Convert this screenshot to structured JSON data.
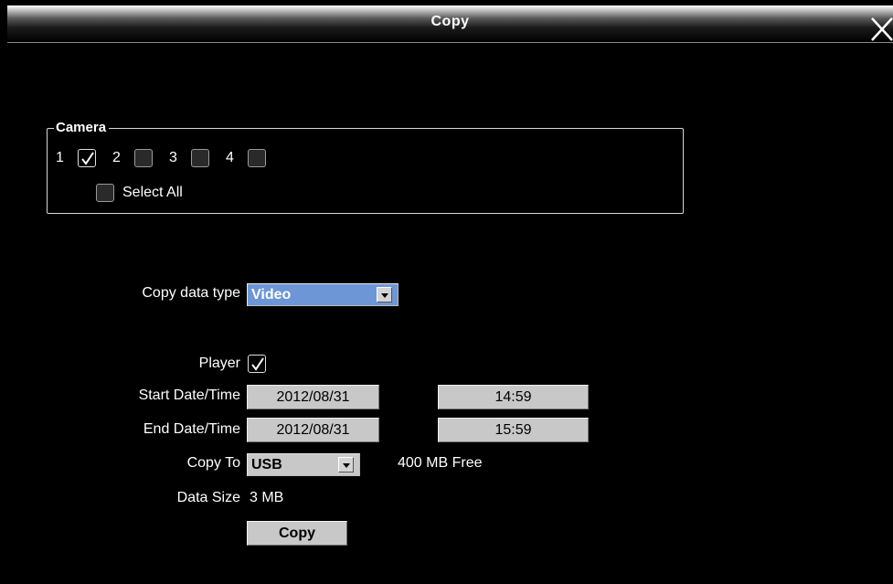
{
  "window": {
    "title": "Copy"
  },
  "camera": {
    "legend": "Camera",
    "channels": [
      {
        "label": "1",
        "checked": true
      },
      {
        "label": "2",
        "checked": false
      },
      {
        "label": "3",
        "checked": false
      },
      {
        "label": "4",
        "checked": false
      }
    ],
    "select_all_label": "Select All",
    "select_all_checked": false
  },
  "form": {
    "copy_data_type_label": "Copy data type",
    "copy_data_type_value": "Video",
    "player_label": "Player",
    "player_checked": true,
    "start_label": "Start Date/Time",
    "start_date": "2012/08/31",
    "start_time": "14:59",
    "end_label": "End Date/Time",
    "end_date": "2012/08/31",
    "end_time": "15:59",
    "copy_to_label": "Copy To",
    "copy_to_value": "USB",
    "free_space": "400 MB Free",
    "data_size_label": "Data Size",
    "data_size_value": "3 MB",
    "copy_button_label": "Copy"
  },
  "colors": {
    "background": "#000000",
    "select_highlight": "#6d96d6",
    "field_gray": "#c8c8c8"
  }
}
